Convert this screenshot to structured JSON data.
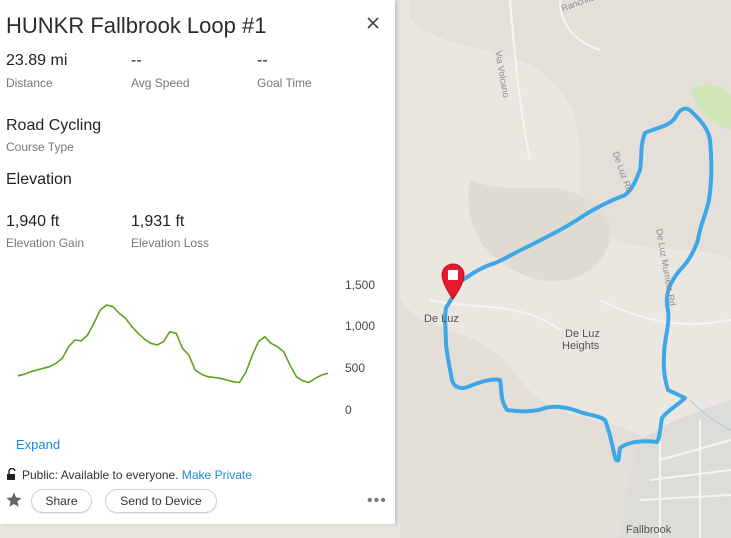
{
  "course": {
    "title": "HUNKR Fallbrook Loop #1",
    "stats": [
      {
        "value": "23.89 mi",
        "label": "Distance"
      },
      {
        "value": "--",
        "label": "Avg Speed"
      },
      {
        "value": "--",
        "label": "Goal Time"
      }
    ],
    "course_type_value": "Road Cycling",
    "course_type_label": "Course Type",
    "elevation_heading": "Elevation",
    "elevation_stats": [
      {
        "value": "1,940 ft",
        "label": "Elevation Gain"
      },
      {
        "value": "1,931 ft",
        "label": "Elevation Loss"
      }
    ]
  },
  "chart_data": {
    "type": "area",
    "title": "",
    "xlabel": "",
    "ylabel": "",
    "y_ticks": [
      "1,500",
      "1,000",
      "500",
      "0"
    ],
    "ylim": [
      0,
      1500
    ],
    "grid": false,
    "series": [
      {
        "color": "#5ba31d",
        "values": [
          410,
          430,
          460,
          480,
          500,
          520,
          560,
          620,
          760,
          840,
          830,
          900,
          1040,
          1200,
          1260,
          1240,
          1160,
          1100,
          1000,
          920,
          850,
          800,
          780,
          820,
          940,
          920,
          740,
          660,
          480,
          430,
          400,
          390,
          380,
          360,
          340,
          330,
          450,
          650,
          820,
          880,
          800,
          760,
          700,
          540,
          400,
          350,
          330,
          380,
          420,
          440
        ]
      }
    ]
  },
  "expand_label": "Expand",
  "visibility": {
    "text": "Public: Available to everyone.",
    "link": "Make Private"
  },
  "actions": {
    "share": "Share",
    "send": "Send to Device",
    "more": "•••"
  },
  "icons": {
    "close": "close-icon",
    "lock": "unlock-icon",
    "star": "star-icon",
    "pin": "map-pin-icon"
  },
  "colors": {
    "route": "#3ea8e6",
    "pin": "#e8192c",
    "elevation": "#5ba31d",
    "link": "#1a8be0"
  },
  "map": {
    "labels": [
      "De Luz",
      "De Luz",
      "Heights",
      "Fallbrook",
      "Via Volcano",
      "Ranchita Rd",
      "De Luz Rd",
      "De Luz Murrieta Rd"
    ]
  }
}
